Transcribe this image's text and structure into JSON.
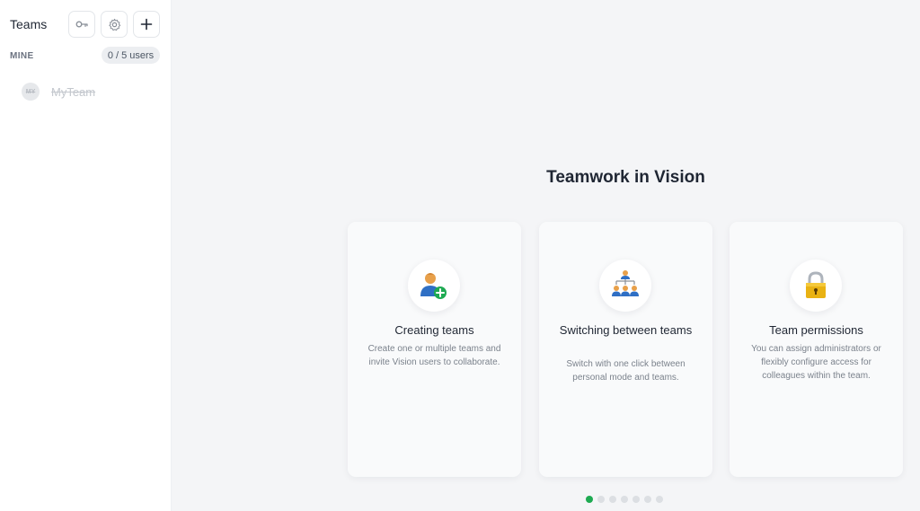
{
  "sidebar": {
    "title": "Teams",
    "buttons": {
      "key": {
        "icon": "key-icon"
      },
      "settings": {
        "icon": "gear-icon"
      },
      "add": {
        "icon": "plus-icon"
      }
    },
    "section_label": "MINE",
    "users_badge": "0 / 5 users",
    "teams": [
      {
        "avatar": "MY",
        "name": "MyTeam"
      }
    ]
  },
  "main": {
    "heading": "Teamwork in Vision",
    "cards": [
      {
        "icon": "user-add-icon",
        "title": "Creating teams",
        "description": "Create one or multiple teams and invite Vision users to collaborate."
      },
      {
        "icon": "team-hierarchy-icon",
        "title": "Switching between teams",
        "description": "Switch with one click between personal mode and teams."
      },
      {
        "icon": "lock-icon",
        "title": "Team permissions",
        "description": "You can assign administrators or flexibly configure access for colleagues within the team."
      }
    ],
    "pagination": {
      "total": 7,
      "active": 1
    }
  },
  "colors": {
    "accent": "#1eaa52",
    "background": "#f4f5f7",
    "card": "#f9fafb"
  }
}
